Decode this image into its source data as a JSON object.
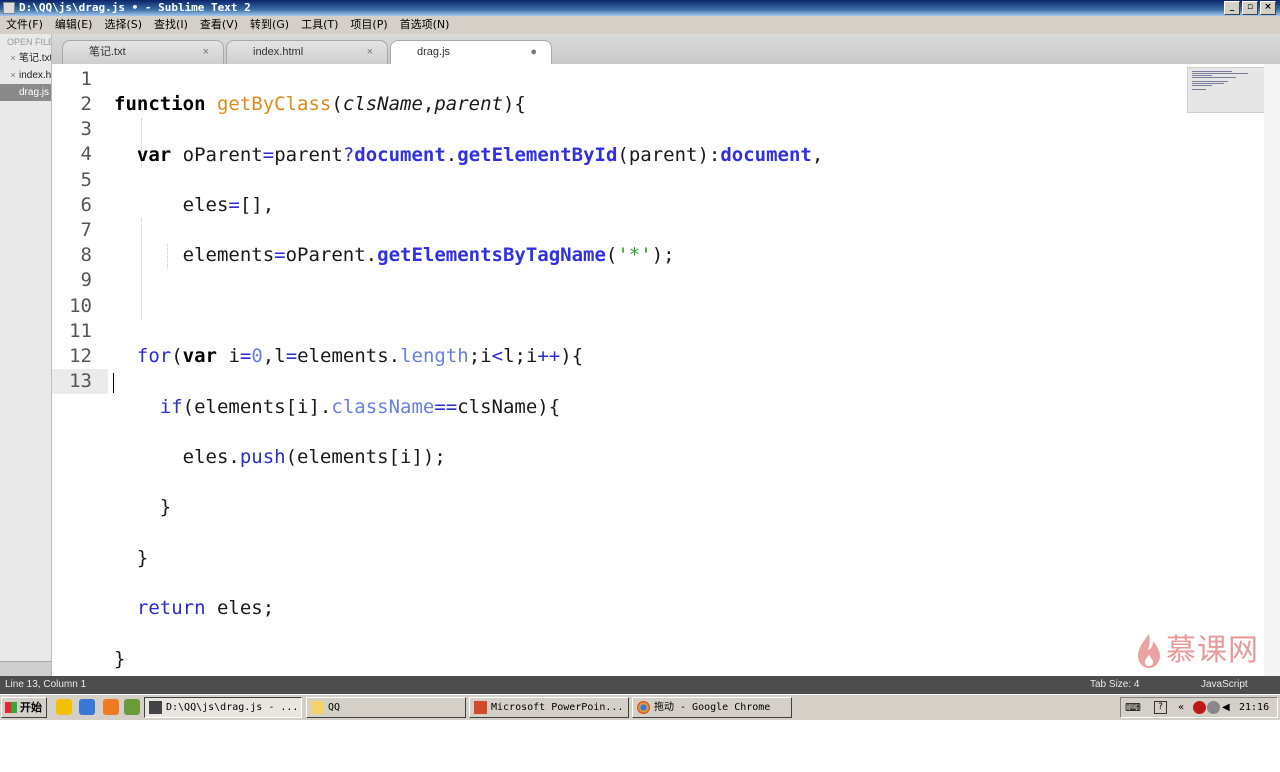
{
  "window": {
    "title": "D:\\QQ\\js\\drag.js • - Sublime Text 2",
    "minimize": "_",
    "maximize": "▫",
    "close": "×"
  },
  "menu": [
    "文件(F)",
    "编辑(E)",
    "选择(S)",
    "查找(I)",
    "查看(V)",
    "转到(G)",
    "工具(T)",
    "项目(P)",
    "首选项(N)"
  ],
  "tabs": [
    {
      "label": "笔记.txt",
      "close": "×"
    },
    {
      "label": "index.html",
      "close": "×"
    },
    {
      "label": "drag.js",
      "close": "●"
    }
  ],
  "sidebar": {
    "header": "OPEN FILES",
    "items": [
      {
        "label": "笔记.txt"
      },
      {
        "label": "index.html"
      },
      {
        "label": "drag.js"
      }
    ]
  },
  "editor": {
    "line_numbers": [
      "1",
      "2",
      "3",
      "4",
      "5",
      "6",
      "7",
      "8",
      "9",
      "10",
      "11",
      "12",
      "13"
    ],
    "current_line": 13
  },
  "watermark": {
    "text": "慕课网"
  },
  "status": {
    "position": "Line 13, Column 1",
    "tab_size": "Tab Size: 4",
    "syntax": "JavaScript"
  },
  "taskbar": {
    "start": "开始",
    "tasks": [
      {
        "label": "D:\\QQ\\js\\drag.js - ..."
      },
      {
        "label": "QQ"
      },
      {
        "label": "Microsoft PowerPoin..."
      },
      {
        "label": "拖动 - Google Chrome"
      }
    ],
    "clock": "21:16"
  },
  "colors": {
    "keyword": "#2b2bd0",
    "function_name": "#e08a1e",
    "builtin": "#3030e0",
    "property": "#6a7fe0",
    "string": "#2aa02a",
    "statusbar": "#4d4d4d"
  }
}
